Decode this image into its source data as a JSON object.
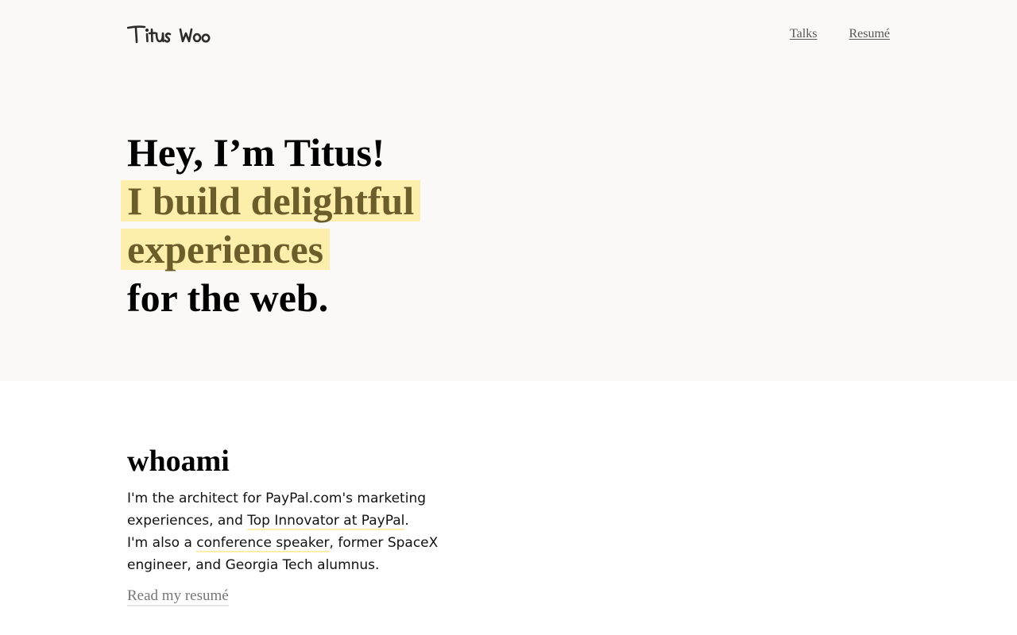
{
  "header": {
    "logo_text": "Titus Woo",
    "nav": [
      {
        "label": "Talks"
      },
      {
        "label": "Resumé"
      }
    ]
  },
  "hero": {
    "line1": "Hey, I’m Titus!",
    "highlight_line1": "I build delightful",
    "highlight_line2": "experiences",
    "line4": "for the web.",
    "highlight_color": "#fdefab",
    "highlight_text_color": "#6b5e2b"
  },
  "about": {
    "heading": "whoami",
    "p1_pre": "I'm the architect for PayPal.com's marketing experiences, and ",
    "p1_link": "Top Innovator at PayPal",
    "p1_post": ".",
    "p2_pre": "I'm also a ",
    "p2_link": "conference speaker",
    "p2_post": ", former SpaceX engineer, and Georgia Tech alumnus.",
    "resume_link": "Read my resumé"
  }
}
